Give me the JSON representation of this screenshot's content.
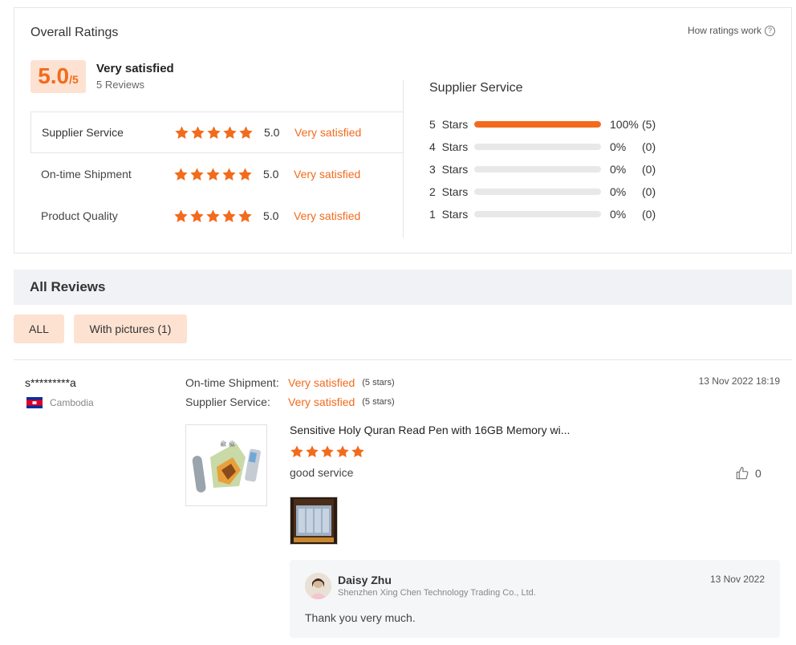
{
  "overall": {
    "title": "Overall Ratings",
    "how_link": "How ratings work",
    "help_glyph": "?",
    "score": "5.0",
    "score_denom": "/5",
    "label": "Very satisfied",
    "count": "5 Reviews"
  },
  "categories": [
    {
      "name": "Supplier Service",
      "stars": 5,
      "score": "5.0",
      "label": "Very satisfied"
    },
    {
      "name": "On-time Shipment",
      "stars": 5,
      "score": "5.0",
      "label": "Very satisfied"
    },
    {
      "name": "Product Quality",
      "stars": 5,
      "score": "5.0",
      "label": "Very satisfied"
    }
  ],
  "distribution": {
    "title": "Supplier Service",
    "rows": [
      {
        "label": "5  Stars",
        "fraction": 1.0,
        "pct": "100%",
        "count": "(5)"
      },
      {
        "label": "4  Stars",
        "fraction": 0.0,
        "pct": "0%",
        "count": "(0)"
      },
      {
        "label": "3  Stars",
        "fraction": 0.0,
        "pct": "0%",
        "count": "(0)"
      },
      {
        "label": "2  Stars",
        "fraction": 0.0,
        "pct": "0%",
        "count": "(0)"
      },
      {
        "label": "1  Stars",
        "fraction": 0.0,
        "pct": "0%",
        "count": "(0)"
      }
    ]
  },
  "reviews_section": {
    "title": "All Reviews",
    "filters": {
      "all": "ALL",
      "with_pictures": "With pictures (1)"
    }
  },
  "review": {
    "reviewer": "s*********a",
    "country": "Cambodia",
    "date": "13 Nov 2022 18:19",
    "shipment_key": "On-time Shipment:",
    "shipment_val": "Very satisfied",
    "shipment_stars": "(5 stars)",
    "service_key": "Supplier Service:",
    "service_val": "Very satisfied",
    "service_stars": "(5 stars)",
    "product_title": "Sensitive Holy Quran Read Pen with 16GB Memory wi...",
    "rating": 5,
    "text": "good service",
    "likes": "0"
  },
  "reply": {
    "name": "Daisy Zhu",
    "company": "Shenzhen Xing Chen Technology Trading Co., Ltd.",
    "date": "13 Nov 2022",
    "text": "Thank you very much."
  },
  "colors": {
    "accent": "#f26b1d",
    "badge_bg": "#fde2d2",
    "track": "#e8e8e8"
  }
}
